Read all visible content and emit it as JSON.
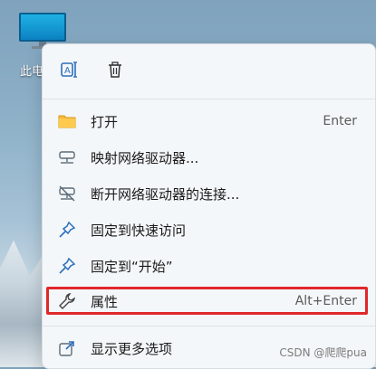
{
  "desktop": {
    "icon_label": "此电"
  },
  "menu": {
    "items": [
      {
        "label": "打开",
        "shortcut": "Enter",
        "icon": "folder-icon"
      },
      {
        "label": "映射网络驱动器...",
        "shortcut": "",
        "icon": "network-drive-icon"
      },
      {
        "label": "断开网络驱动器的连接...",
        "shortcut": "",
        "icon": "disconnect-drive-icon"
      },
      {
        "label": "固定到快速访问",
        "shortcut": "",
        "icon": "pin-icon"
      },
      {
        "label": "固定到“开始”",
        "shortcut": "",
        "icon": "pin-icon"
      },
      {
        "label": "属性",
        "shortcut": "Alt+Enter",
        "icon": "wrench-icon"
      },
      {
        "label": "显示更多选项",
        "shortcut": "",
        "icon": "external-icon"
      }
    ],
    "highlight_color": "#e0282a"
  },
  "watermark": "CSDN @爬爬pua"
}
